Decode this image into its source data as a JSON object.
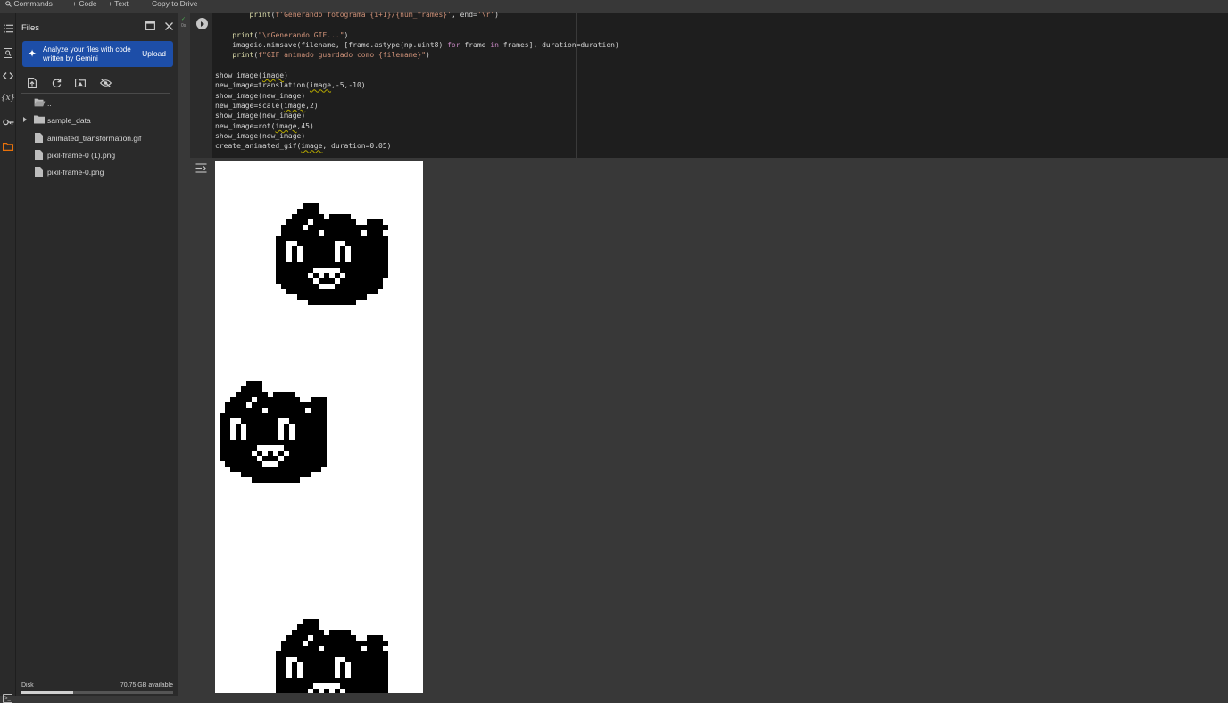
{
  "topbar": {
    "commands": "Commands",
    "code": "+ Code",
    "text": "+ Text",
    "copy_to_drive": "Copy to Drive"
  },
  "rail": {
    "icons": [
      "table-of-contents-icon",
      "search-icon",
      "code-snippets-icon",
      "variables-icon",
      "secrets-key-icon",
      "folder-icon"
    ]
  },
  "panel": {
    "title": "Files",
    "banner_text": "Analyze your files with code written by Gemini",
    "banner_action": "Upload",
    "files": [
      {
        "name": "..",
        "type": "parent-folder"
      },
      {
        "name": "sample_data",
        "type": "folder"
      },
      {
        "name": "animated_transformation.gif",
        "type": "file"
      },
      {
        "name": "pixil-frame-0 (1).png",
        "type": "file"
      },
      {
        "name": "pixil-frame-0.png",
        "type": "file"
      }
    ],
    "disk_label": "Disk",
    "disk_available": "70.75 GB available",
    "disk_used_fraction": 0.34
  },
  "cell": {
    "status": "0s",
    "code_lines": [
      "        print(f'Generando fotograma {i+1}/{num_frames}', end='\\r')",
      "",
      "    print(\"\\nGenerando GIF...\")",
      "    imageio.mimsave(filename, [frame.astype(np.uint8) for frame in frames], duration=duration)",
      "    print(f\"GIF animado guardado como {filename}\")",
      "",
      "show_image(image)",
      "new_image=translation(image,-5,-10)",
      "show_image(new_image)",
      "new_image=scale(image,2)",
      "show_image(new_image)",
      "new_image=rot(image,45)",
      "show_image(new_image)",
      "create_animated_gif(image, duration=0.05)"
    ]
  },
  "colors": {
    "accent": "#1d4ea8",
    "folder_active": "#e8710a",
    "background": "#383838",
    "code_bg": "#1e1e1e"
  }
}
